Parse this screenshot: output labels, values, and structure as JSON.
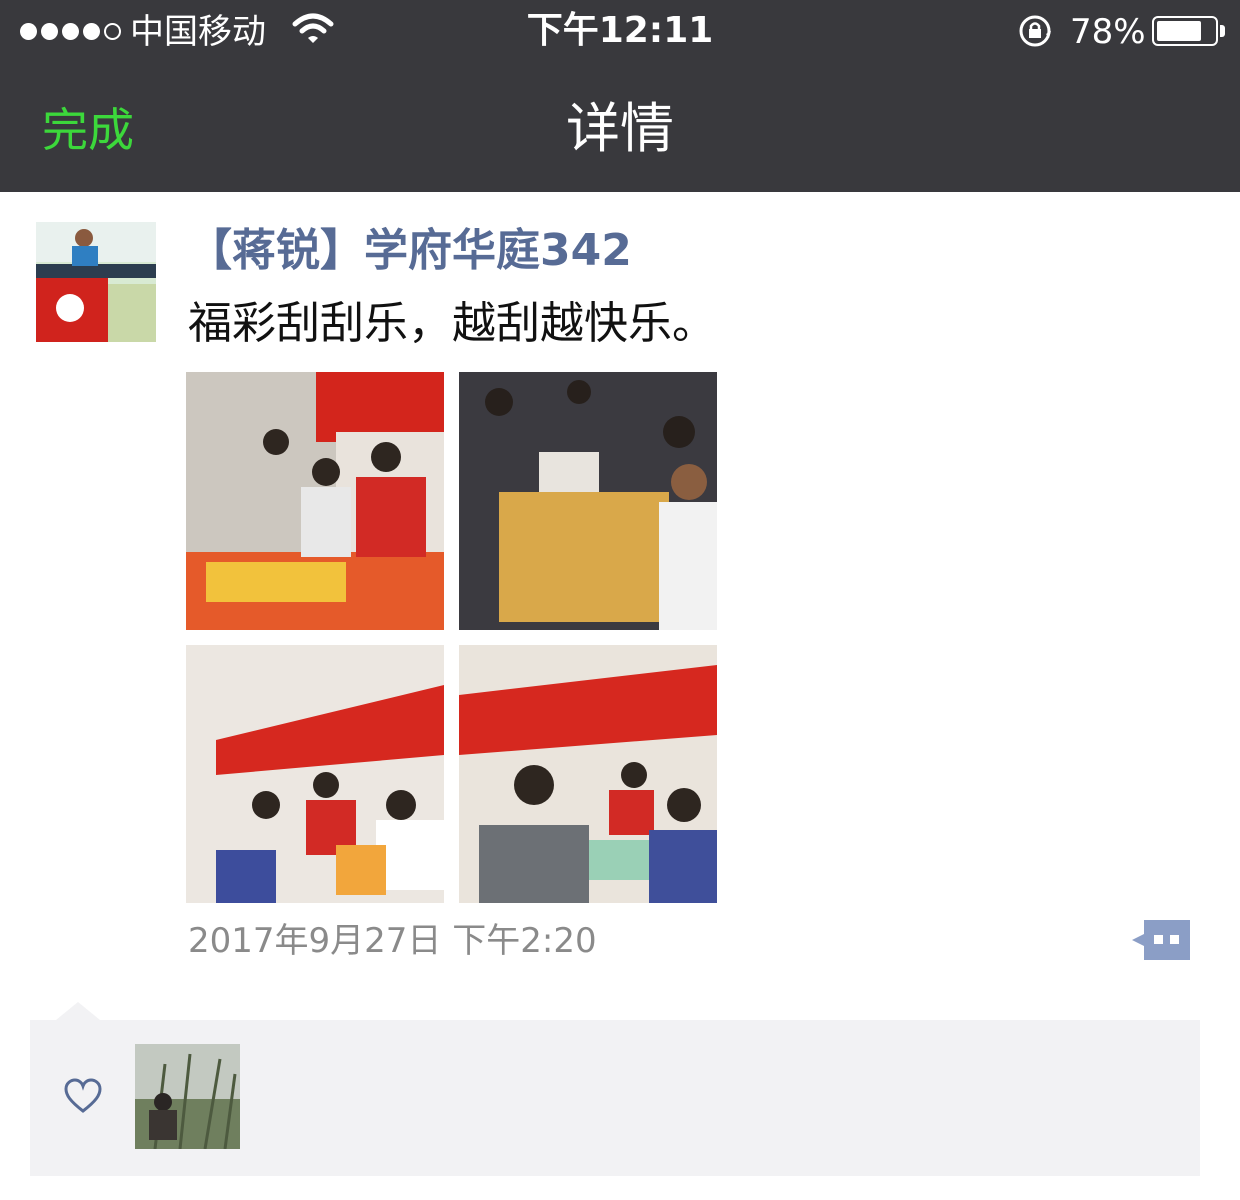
{
  "status_bar": {
    "signal_filled": 4,
    "signal_total": 5,
    "carrier": "中国移动",
    "time": "下午12:11",
    "battery_text": "78%",
    "battery_level": 0.78,
    "icons": [
      "signal-dots-icon",
      "wifi-icon",
      "rotation-lock-icon",
      "battery-icon"
    ]
  },
  "nav": {
    "done_label": "完成",
    "title": "详情"
  },
  "post": {
    "author": "【蒋锐】学府华庭342",
    "content": "福彩刮刮乐，越刮越快乐。",
    "photo_count": 4,
    "timestamp": "2017年9月27日 下午2:20",
    "comment_icon": "comment-bubble-icon"
  },
  "likes": {
    "icon": "heart-outline-icon",
    "liker_count": 1
  },
  "colors": {
    "bar_bg": "#39393d",
    "done_green": "#3cd83b",
    "author_blue": "#576b95",
    "likes_bg": "#f2f2f4",
    "comment_icon": "#8b9ec6"
  }
}
